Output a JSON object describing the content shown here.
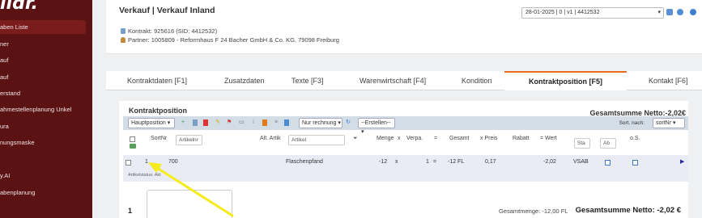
{
  "sidebar": {
    "logo": "ildr.",
    "items": [
      {
        "label": "aben Liste",
        "active": true
      },
      {
        "label": "ner",
        "active": false
      },
      {
        "label": "auf",
        "active": false
      },
      {
        "label": "auf",
        "active": false
      },
      {
        "label": "erstand",
        "active": false
      },
      {
        "label": "ahmestellenplanung Unkel",
        "active": false
      },
      {
        "label": "ura",
        "active": false
      },
      {
        "label": "nungsmaske",
        "active": false
      },
      {
        "label": "y.AI",
        "active": false
      },
      {
        "label": "abenplanung",
        "active": false
      }
    ]
  },
  "header": {
    "title": "Verkauf | Verkauf Inland",
    "contract": "Kontrakt: 925616 (SID: 4412532)",
    "partner": "Partner: 1005809 - Reformhaus F 24 Bacher GmbH & Co. KG, 79098 Freiburg",
    "date_select": "28-01-2025 | 0 | v1 | 4412532"
  },
  "tabs": [
    {
      "label": "Kontraktdaten [F1]"
    },
    {
      "label": "Zusatzdaten"
    },
    {
      "label": "Texte [F3]"
    },
    {
      "label": "Warenwirtschaft [F4]"
    },
    {
      "label": "Kondition"
    },
    {
      "label": "Kontraktposition [F5]",
      "active": true
    },
    {
      "label": "Kontakt [F6]"
    }
  ],
  "position": {
    "title": "Kontraktposition",
    "gesamtsumme_top": "Gesamtsumme Netto:-2,02€",
    "toolbar": {
      "hauptposition": "Hauptposition",
      "nur_rechnung": "Nur rechnung",
      "erstellen": "--Erstellen--",
      "sort_label": "Sort. nach:",
      "sort_value": "sortNr"
    },
    "columns": {
      "sortnr": "SortNr",
      "artikelnr_placeholder": "Artikelnr",
      "alt_artik": "Alt. Artik",
      "artikel_placeholder": "Artikel",
      "menge": "Menge",
      "x1": "x",
      "verpa": "Verpa.",
      "eq1": "=",
      "gesamt": "Gesamt",
      "x_preis": "x Preis",
      "rabatt": "Rabatt",
      "eq_wert": "= Wert",
      "sta_placeholder": "Sta",
      "ab_placeholder": "Ab",
      "os": "o.S."
    },
    "row": {
      "sortnr": "1",
      "artikelnr": "700",
      "artikel": "Flaschenpfand",
      "menge": "-12",
      "x": "x",
      "verpa": "1",
      "eq": "=",
      "gesamt": "-12 FL",
      "preis": "0,17",
      "wert": "-2,02",
      "code": "VSAB"
    },
    "status_text": "Artikelstatus: Akt",
    "bottom_num": "1",
    "gesamtmenge": "Gesamtmenge: -12,00 FL",
    "gesamtsumme_bottom": "Gesamtsumme Netto: -2,02 €"
  },
  "colors": {
    "sidebar": "#5a1212",
    "active_tab": "#e86c1a",
    "toolbar": "#d2dde6",
    "row": "#e9ecf4",
    "arrow": "#f5ea1a"
  }
}
